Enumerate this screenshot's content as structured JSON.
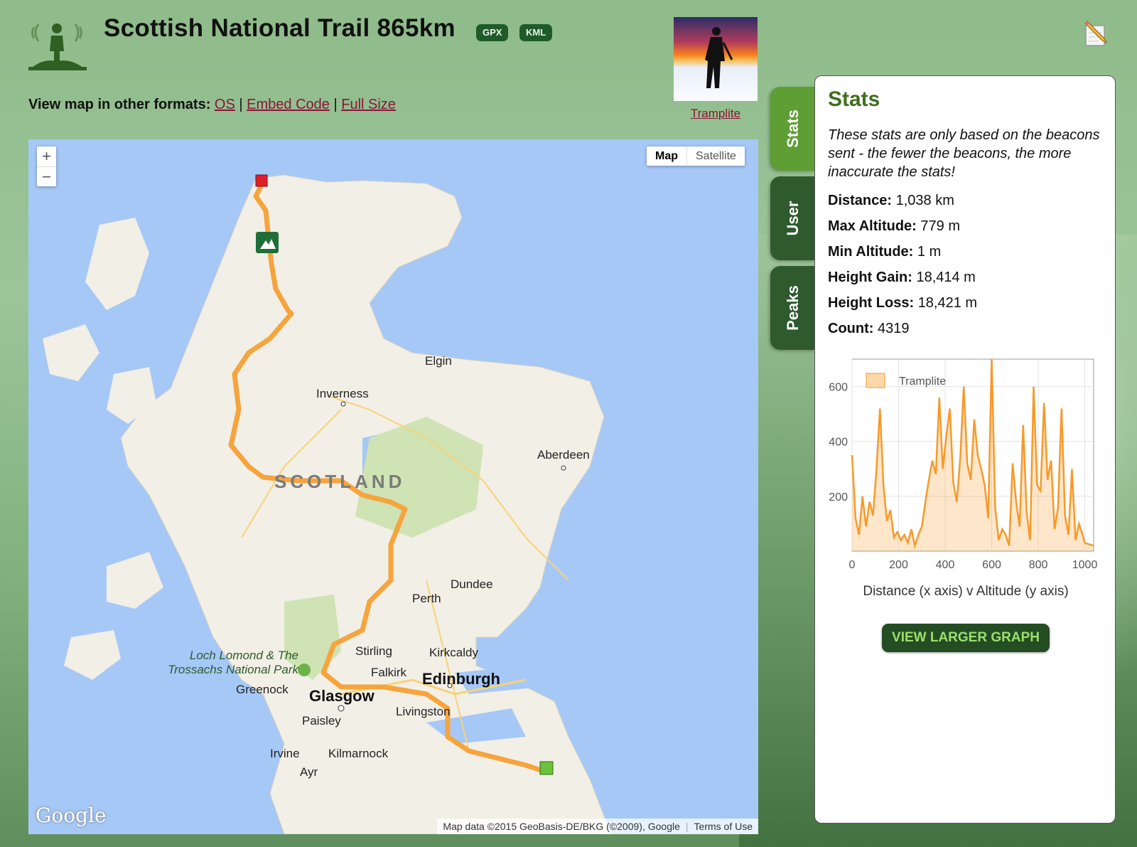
{
  "header": {
    "title": "Scottish National Trail 865km",
    "badges": [
      "GPX",
      "KML"
    ]
  },
  "formats": {
    "label": "View map in other formats:",
    "links": [
      "OS",
      "Embed Code",
      "Full Size"
    ],
    "separator": "|"
  },
  "user": {
    "thumbnail_caption": "Tramplite"
  },
  "map": {
    "zoom_in": "+",
    "zoom_out": "−",
    "types": [
      "Map",
      "Satellite"
    ],
    "active_type": "Map",
    "labels": {
      "country": "SCOTLAND",
      "elgin": "Elgin",
      "inverness": "Inverness",
      "aberdeen": "Aberdeen",
      "dundee": "Dundee",
      "perth": "Perth",
      "stirling": "Stirling",
      "kirkcaldy": "Kirkcaldy",
      "falkirk": "Falkirk",
      "edinburgh": "Edinburgh",
      "glasgow": "Glasgow",
      "greenock": "Greenock",
      "livingston": "Livingston",
      "paisley": "Paisley",
      "irvine": "Irvine",
      "kilmarnock": "Kilmarnock",
      "ayr": "Ayr",
      "park_line1": "Loch Lomond & The",
      "park_line2": "Trossachs National Park"
    },
    "google_logo": "Google",
    "attribution": "Map data ©2015 GeoBasis-DE/BKG (©2009), Google",
    "terms": "Terms of Use",
    "colors": {
      "water": "#a6c8f7",
      "land": "#f2efe6",
      "route": "#f6a43d",
      "park": "#cfe3b4"
    }
  },
  "tabs": [
    "Stats",
    "User",
    "Peaks"
  ],
  "active_tab": "Stats",
  "stats": {
    "heading": "Stats",
    "note": "These stats are only based on the beacons sent - the fewer the beacons, the more inaccurate the stats!",
    "items": [
      {
        "label": "Distance:",
        "value": "1,038 km"
      },
      {
        "label": "Max Altitude:",
        "value": "779 m"
      },
      {
        "label": "Min Altitude:",
        "value": "1 m"
      },
      {
        "label": "Height Gain:",
        "value": "18,414 m"
      },
      {
        "label": "Height Loss:",
        "value": "18,421 m"
      },
      {
        "label": "Count:",
        "value": "4319"
      }
    ],
    "button": "VIEW LARGER GRAPH"
  },
  "chart_data": {
    "type": "area",
    "title": "",
    "xlabel": "Distance (x axis) v Altitude (y axis)",
    "ylabel": "",
    "series": [
      {
        "name": "Tramplite",
        "color": "#f69a2b",
        "x": [
          0,
          15,
          30,
          45,
          60,
          75,
          90,
          105,
          120,
          135,
          150,
          165,
          180,
          195,
          210,
          225,
          240,
          255,
          270,
          285,
          300,
          315,
          330,
          345,
          360,
          375,
          390,
          405,
          420,
          435,
          450,
          465,
          480,
          495,
          510,
          525,
          540,
          555,
          570,
          585,
          600,
          615,
          630,
          645,
          660,
          675,
          690,
          705,
          720,
          735,
          750,
          765,
          780,
          795,
          810,
          825,
          840,
          855,
          870,
          885,
          900,
          915,
          930,
          945,
          960,
          975,
          990,
          1000,
          1038
        ],
        "y": [
          350,
          120,
          60,
          200,
          90,
          180,
          130,
          300,
          520,
          240,
          110,
          150,
          50,
          70,
          40,
          60,
          30,
          80,
          20,
          60,
          90,
          180,
          260,
          330,
          280,
          560,
          300,
          420,
          520,
          250,
          180,
          340,
          600,
          320,
          260,
          480,
          350,
          300,
          240,
          120,
          700,
          160,
          40,
          80,
          60,
          20,
          320,
          180,
          90,
          460,
          140,
          40,
          600,
          240,
          220,
          540,
          260,
          330,
          80,
          160,
          520,
          130,
          60,
          300,
          40,
          100,
          60,
          30,
          20
        ]
      }
    ],
    "x_ticks": [
      0,
      200,
      400,
      600,
      800,
      1000
    ],
    "y_ticks": [
      200,
      400,
      600
    ],
    "xlim": [
      0,
      1038
    ],
    "ylim": [
      0,
      700
    ],
    "legend": "top-left",
    "grid": true
  }
}
